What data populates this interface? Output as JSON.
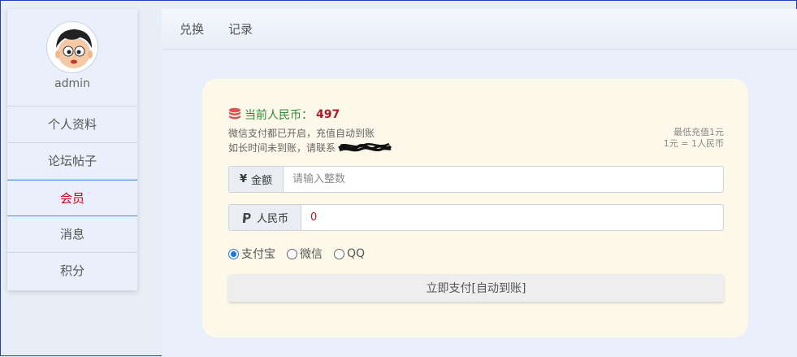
{
  "sidebar": {
    "username": "admin",
    "items": [
      {
        "label": "个人资料"
      },
      {
        "label": "论坛帖子"
      },
      {
        "label": "会员"
      },
      {
        "label": "消息"
      },
      {
        "label": "积分"
      }
    ],
    "active_index": 2
  },
  "tabs": [
    {
      "label": "兑换"
    },
    {
      "label": "记录"
    }
  ],
  "recharge": {
    "balance_label": "当前人民币：",
    "balance_value": "497",
    "note1": "微信支付都已开启，充值自动到账",
    "note2": "如长时间未到账，请联系",
    "min_note": "最低充值1元",
    "rate_note": "1元 = 1人民币",
    "amount": {
      "symbol": "¥",
      "label": "金额",
      "placeholder": "请输入整数",
      "value": ""
    },
    "rmb": {
      "label": "人民币",
      "value": "0"
    },
    "payment_methods": [
      {
        "label": "支付宝",
        "checked": true
      },
      {
        "label": "微信",
        "checked": false
      },
      {
        "label": "QQ",
        "checked": false
      }
    ],
    "submit_label": "立即支付[自动到账]"
  },
  "colors": {
    "active_nav": "#d0021b",
    "balance_label": "#2d8a34",
    "balance_value": "#b0172a",
    "card_bg": "#fdf9ea",
    "radio_accent": "#1a73e8"
  },
  "icons": {
    "coin": "coin-stack-icon",
    "paypal": "paypal-icon"
  }
}
